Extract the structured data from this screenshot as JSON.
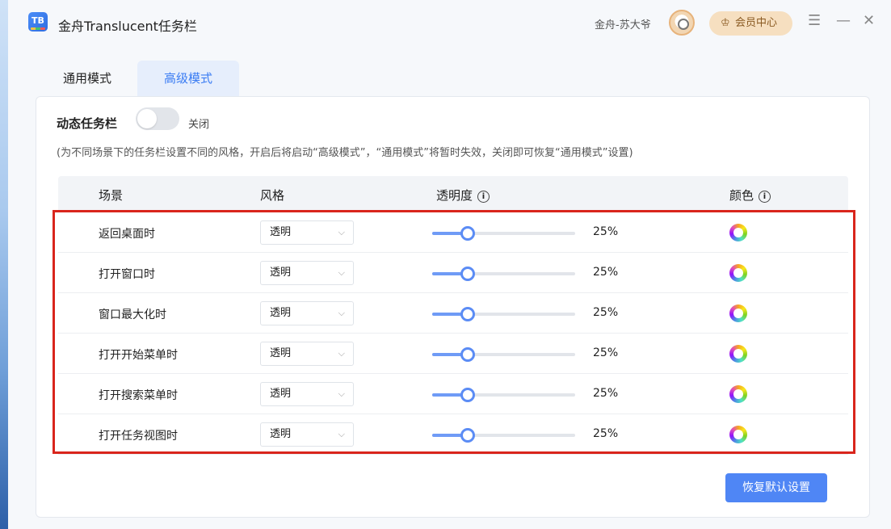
{
  "app": {
    "title": "金舟Translucent任务栏",
    "logo_text": "TB"
  },
  "header": {
    "username": "金舟-苏大爷",
    "vip_label": "会员中心",
    "menu_icon": "hamburger-icon",
    "min_icon": "minimize-icon",
    "close_icon": "close-icon"
  },
  "tabs": [
    {
      "label": "通用模式",
      "active": false
    },
    {
      "label": "高级模式",
      "active": true
    }
  ],
  "dynamic_taskbar": {
    "label": "动态任务栏",
    "enabled": false,
    "state_label": "关闭",
    "hint": "(为不同场景下的任务栏设置不同的风格，开启后将启动“高级模式”，“通用模式”将暂时失效，关闭即可恢复“通用模式”设置)"
  },
  "table": {
    "headers": {
      "scene": "场景",
      "style": "风格",
      "opacity": "透明度",
      "color": "颜色"
    },
    "rows": [
      {
        "scene": "返回桌面时",
        "style": "透明",
        "opacity_value": 25,
        "opacity_label": "25%"
      },
      {
        "scene": "打开窗口时",
        "style": "透明",
        "opacity_value": 25,
        "opacity_label": "25%"
      },
      {
        "scene": "窗口最大化时",
        "style": "透明",
        "opacity_value": 25,
        "opacity_label": "25%"
      },
      {
        "scene": "打开开始菜单时",
        "style": "透明",
        "opacity_value": 25,
        "opacity_label": "25%"
      },
      {
        "scene": "打开搜索菜单时",
        "style": "透明",
        "opacity_value": 25,
        "opacity_label": "25%"
      },
      {
        "scene": "打开任务视图时",
        "style": "透明",
        "opacity_value": 25,
        "opacity_label": "25%"
      }
    ]
  },
  "reset_button": "恢复默认设置",
  "colors": {
    "accent": "#4f86f5",
    "highlight_border": "#d9251c",
    "vip_bg": "#f6dfc0"
  }
}
